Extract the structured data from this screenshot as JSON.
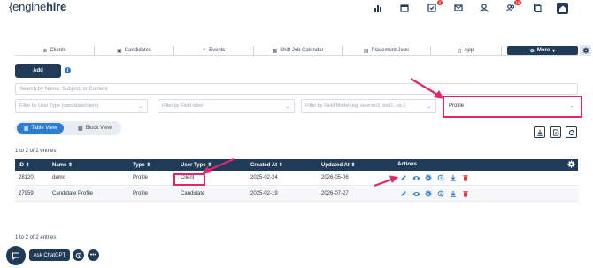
{
  "brand": {
    "prefix": "{",
    "light": "engine",
    "bold": "hire"
  },
  "top_icons": [
    {
      "name": "reports-icon",
      "badge": ""
    },
    {
      "name": "calendar-icon",
      "badge": ""
    },
    {
      "name": "tasks-icon",
      "badge": "5"
    },
    {
      "name": "mail-icon",
      "badge": ""
    },
    {
      "name": "user-icon",
      "badge": ""
    },
    {
      "name": "users-icon",
      "badge": "16"
    },
    {
      "name": "pages-icon",
      "badge": ""
    },
    {
      "name": "home-icon",
      "badge": ""
    }
  ],
  "nav": {
    "clients": "Clients",
    "candidates": "Candidates",
    "events": "Events",
    "shift_calendar": "Shift Job Calendar",
    "placement_jobs": "Placement Jobs",
    "app": "App",
    "more": "More"
  },
  "add_button": "Add",
  "search_placeholder": "Search by Name, Subject, or Content",
  "filters": {
    "user_type": "Filter by User Type (candidate/client)",
    "field_label": "Filter by Field label",
    "field_model": "Filter by Field Model (eg. selector2, text1, etc.)",
    "selected": "Profile"
  },
  "views": {
    "table": "Table View",
    "block": "Block View"
  },
  "entries_text": "1 to 2 of 2 entries",
  "table": {
    "headers": [
      "ID",
      "Name",
      "Type",
      "User Type",
      "Created At",
      "Updated At",
      "Actions"
    ],
    "rows": [
      {
        "id": "28120",
        "name": "demo",
        "type": "Profile",
        "user_type": "Client",
        "created": "2025-02-24",
        "updated": "2026-05-06"
      },
      {
        "id": "27959",
        "name": "Candidate Profile",
        "type": "Profile",
        "user_type": "Candidate",
        "created": "2025-02-19",
        "updated": "2026-07-27"
      }
    ]
  },
  "ask_chatgpt": "Ask ChatGPT",
  "colors": {
    "navy": "#1f3b57",
    "accent": "#2f7dd3",
    "highlight": "#e8256b",
    "delete": "#e53935"
  }
}
